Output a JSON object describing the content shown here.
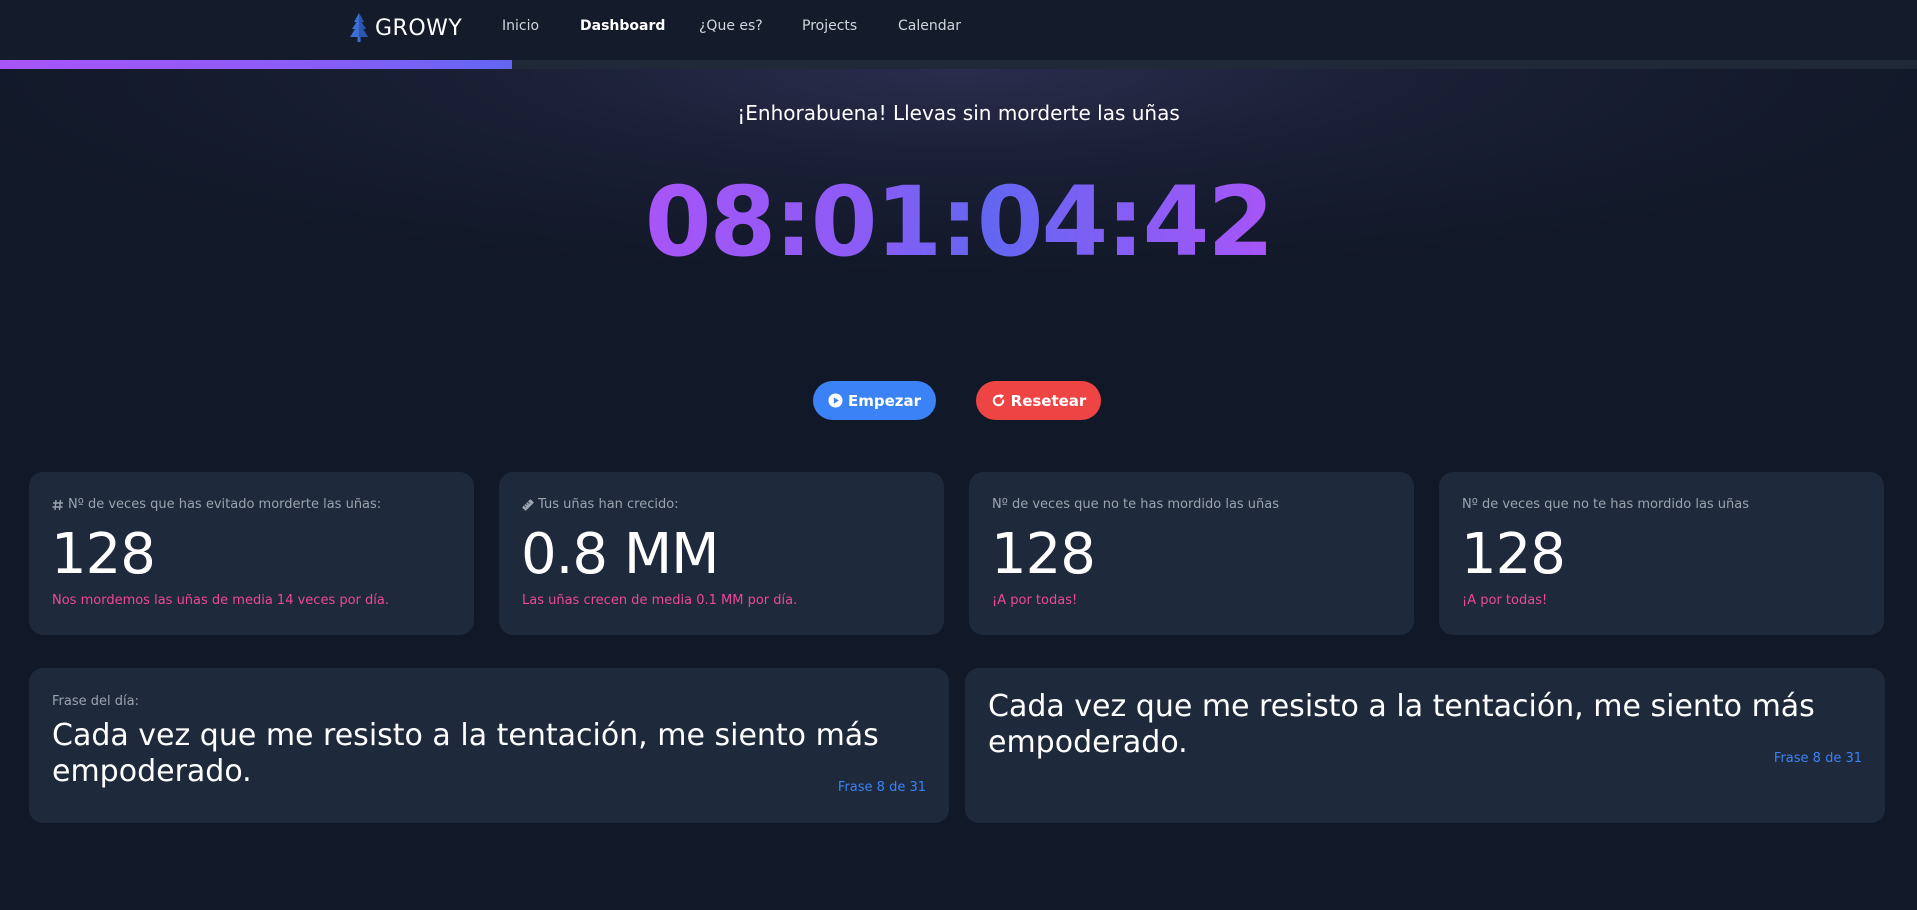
{
  "nav": {
    "brand": "GROWY",
    "links": [
      "Inicio",
      "Dashboard",
      "¿Que es?",
      "Projects",
      "Calendar"
    ],
    "active": "Dashboard"
  },
  "progress": {
    "fraction": 0.267
  },
  "hero": {
    "message": "¡Enhorabuena! Llevas sin morderte las uñas",
    "timer": "08:01:04:42"
  },
  "buttons": {
    "start": "Empezar",
    "reset": "Resetear"
  },
  "stats": [
    {
      "icon": "hash-icon",
      "label": "Nº de veces que has evitado morderte las uñas:",
      "value": "128",
      "note": "Nos mordemos las uñas de media 14 veces por día."
    },
    {
      "icon": "ruler-icon",
      "label": "Tus uñas han crecido:",
      "value": "0.8 MM",
      "note": "Las uñas crecen de media 0.1 MM por día."
    },
    {
      "icon": "",
      "label": "Nº de veces que no te has mordido las uñas",
      "value": "128",
      "note": "¡A por todas!"
    },
    {
      "icon": "",
      "label": "Nº de veces que no te has mordido las uñas",
      "value": "128",
      "note": "¡A por todas!"
    }
  ],
  "quotes": [
    {
      "label": "Frase del día:",
      "text": "Cada vez que me resisto a la tentación, me siento más empoderado.",
      "count": "Frase 8 de 31"
    },
    {
      "label": "",
      "text": "Cada vez que me resisto a la tentación, me siento más empoderado.",
      "count": "Frase 8 de 31"
    }
  ],
  "colors": {
    "background": "#111827",
    "card": "#1e293b",
    "accent_purple": "#8b5cf6",
    "start_button": "#3b82f6",
    "reset_button": "#ef4444",
    "note_pink": "#ec4899",
    "quote_count_blue": "#3b82f6"
  }
}
